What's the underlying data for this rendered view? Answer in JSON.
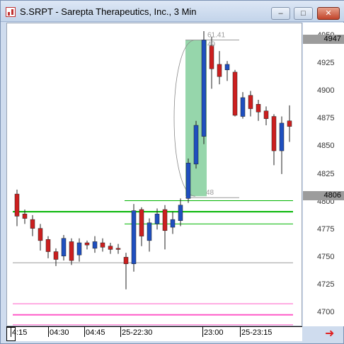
{
  "window": {
    "title": "S.SRPT - Sarepta Therapeutics, Inc., 3 Min",
    "minimize_glyph": "–",
    "maximize_glyph": "□",
    "close_glyph": "✕"
  },
  "price_axis": {
    "ticks": [
      "4950",
      "4925",
      "4900",
      "4875",
      "4850",
      "4825",
      "4800",
      "4775",
      "4750",
      "4725",
      "4700"
    ],
    "tags": [
      {
        "label": "4947",
        "price": 4947
      },
      {
        "label": "4806",
        "price": 4806
      }
    ]
  },
  "time_axis": {
    "labels": [
      "4:15",
      "04:30",
      "04:45",
      "25-22:30",
      "23:00",
      "25-23:15"
    ]
  },
  "annotations": {
    "top_label": "61.41",
    "top_sub": "49",
    "bottom_label": "48"
  },
  "colors": {
    "up": "#1f4fbf",
    "down": "#cc1f1f",
    "wick": "#222222",
    "green_line": "#00b400",
    "pink_line": "#ff5ac8",
    "gray_line": "#9a9a9a",
    "highlight": "#84cf9c"
  },
  "chart_data": {
    "type": "candlestick",
    "title": "S.SRPT - Sarepta Therapeutics, Inc., 3 Min",
    "ylim": [
      4690,
      4960
    ],
    "yticks": [
      4700,
      4725,
      4750,
      4775,
      4800,
      4825,
      4850,
      4875,
      4900,
      4925,
      4950
    ],
    "candles": [
      {
        "o": 4808,
        "h": 4812,
        "l": 4779,
        "c": 4788
      },
      {
        "o": 4790,
        "h": 4794,
        "l": 4781,
        "c": 4786
      },
      {
        "o": 4785,
        "h": 4789,
        "l": 4770,
        "c": 4777
      },
      {
        "o": 4777,
        "h": 4781,
        "l": 4757,
        "c": 4766
      },
      {
        "o": 4767,
        "h": 4770,
        "l": 4750,
        "c": 4756
      },
      {
        "o": 4756,
        "h": 4759,
        "l": 4743,
        "c": 4749
      },
      {
        "o": 4752,
        "h": 4771,
        "l": 4748,
        "c": 4768
      },
      {
        "o": 4765,
        "h": 4768,
        "l": 4744,
        "c": 4748
      },
      {
        "o": 4753,
        "h": 4768,
        "l": 4747,
        "c": 4764
      },
      {
        "o": 4764,
        "h": 4766,
        "l": 4758,
        "c": 4762
      },
      {
        "o": 4759,
        "h": 4770,
        "l": 4755,
        "c": 4765
      },
      {
        "o": 4764,
        "h": 4768,
        "l": 4756,
        "c": 4760
      },
      {
        "o": 4761,
        "h": 4764,
        "l": 4754,
        "c": 4758
      },
      {
        "o": 4759,
        "h": 4763,
        "l": 4754,
        "c": 4758
      },
      {
        "o": 4751,
        "h": 4755,
        "l": 4722,
        "c": 4745
      },
      {
        "o": 4745,
        "h": 4799,
        "l": 4738,
        "c": 4793
      },
      {
        "o": 4794,
        "h": 4796,
        "l": 4761,
        "c": 4770
      },
      {
        "o": 4766,
        "h": 4786,
        "l": 4756,
        "c": 4782
      },
      {
        "o": 4781,
        "h": 4795,
        "l": 4776,
        "c": 4790
      },
      {
        "o": 4794,
        "h": 4798,
        "l": 4758,
        "c": 4775
      },
      {
        "o": 4778,
        "h": 4792,
        "l": 4772,
        "c": 4785
      },
      {
        "o": 4784,
        "h": 4804,
        "l": 4779,
        "c": 4798
      },
      {
        "o": 4804,
        "h": 4840,
        "l": 4800,
        "c": 4836
      },
      {
        "o": 4835,
        "h": 4874,
        "l": 4831,
        "c": 4870
      },
      {
        "o": 4860,
        "h": 4955,
        "l": 4853,
        "c": 4947
      },
      {
        "o": 4942,
        "h": 4950,
        "l": 4903,
        "c": 4921
      },
      {
        "o": 4925,
        "h": 4937,
        "l": 4907,
        "c": 4914
      },
      {
        "o": 4920,
        "h": 4928,
        "l": 4910,
        "c": 4925
      },
      {
        "o": 4918,
        "h": 4920,
        "l": 4878,
        "c": 4879
      },
      {
        "o": 4878,
        "h": 4900,
        "l": 4876,
        "c": 4895
      },
      {
        "o": 4897,
        "h": 4901,
        "l": 4878,
        "c": 4885
      },
      {
        "o": 4889,
        "h": 4893,
        "l": 4874,
        "c": 4882
      },
      {
        "o": 4883,
        "h": 4887,
        "l": 4870,
        "c": 4876
      },
      {
        "o": 4878,
        "h": 4880,
        "l": 4834,
        "c": 4847
      },
      {
        "o": 4847,
        "h": 4878,
        "l": 4826,
        "c": 4872
      },
      {
        "o": 4874,
        "h": 4888,
        "l": 4855,
        "c": 4869
      }
    ],
    "horizontal_lines": [
      {
        "price": 4802,
        "color": "green",
        "style": "solid",
        "from_candle": 14
      },
      {
        "price": 4792,
        "color": "green",
        "style": "solid-thick",
        "from_candle": 0
      },
      {
        "price": 4781,
        "color": "green",
        "style": "solid",
        "from_candle": 14
      },
      {
        "price": 4746,
        "color": "gray",
        "style": "solid",
        "from_candle": 0
      },
      {
        "price": 4709,
        "color": "pink",
        "style": "solid",
        "from_candle": 0
      },
      {
        "price": 4699,
        "color": "pink",
        "style": "solid-thick",
        "from_candle": 0
      },
      {
        "price": 4690,
        "color": "pink",
        "style": "solid",
        "from_candle": 0
      }
    ],
    "highlight_range": {
      "from_candle": 22,
      "to_candle": 24,
      "low": 4806,
      "high": 4947
    }
  }
}
